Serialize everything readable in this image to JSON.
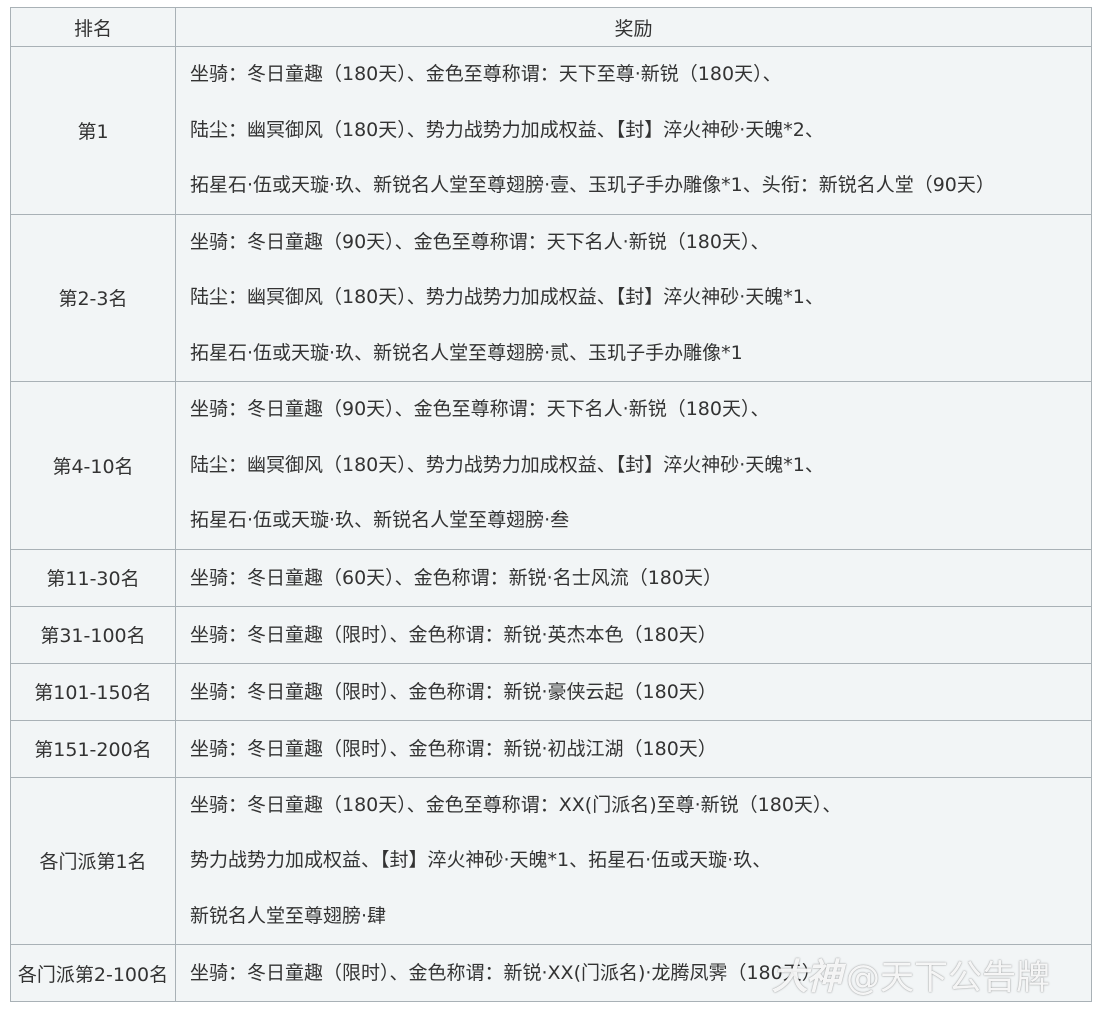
{
  "table": {
    "headers": [
      "排名",
      "奖励"
    ],
    "rows": [
      {
        "rank": "第1",
        "lines": [
          "坐骑：冬日童趣（180天）、金色至尊称谓：天下至尊·新锐（180天）、",
          "陆尘：幽冥御风（180天）、势力战势力加成权益、【封】淬火神砂·天魄*2、",
          "拓星石·伍或天璇·玖、新锐名人堂至尊翅膀·壹、玉玑子手办雕像*1、头衔：新锐名人堂（90天）"
        ]
      },
      {
        "rank": "第2-3名",
        "lines": [
          "坐骑：冬日童趣（90天）、金色至尊称谓：天下名人·新锐（180天）、",
          "陆尘：幽冥御风（180天）、势力战势力加成权益、【封】淬火神砂·天魄*1、",
          "拓星石·伍或天璇·玖、新锐名人堂至尊翅膀·贰、玉玑子手办雕像*1"
        ]
      },
      {
        "rank": "第4-10名",
        "lines": [
          "坐骑：冬日童趣（90天）、金色至尊称谓：天下名人·新锐（180天）、",
          "陆尘：幽冥御风（180天）、势力战势力加成权益、【封】淬火神砂·天魄*1、",
          "拓星石·伍或天璇·玖、新锐名人堂至尊翅膀·叁"
        ]
      },
      {
        "rank": "第11-30名",
        "lines": [
          "坐骑：冬日童趣（60天）、金色称谓：新锐·名士风流（180天）"
        ]
      },
      {
        "rank": "第31-100名",
        "lines": [
          "坐骑：冬日童趣（限时）、金色称谓：新锐·英杰本色（180天）"
        ]
      },
      {
        "rank": "第101-150名",
        "lines": [
          "坐骑：冬日童趣（限时）、金色称谓：新锐·豪侠云起（180天）"
        ]
      },
      {
        "rank": "第151-200名",
        "lines": [
          "坐骑：冬日童趣（限时）、金色称谓：新锐·初战江湖（180天）"
        ]
      },
      {
        "rank": "各门派第1名",
        "lines": [
          "坐骑：冬日童趣（180天）、金色至尊称谓：XX(门派名)至尊·新锐（180天）、",
          "势力战势力加成权益、【封】淬火神砂·天魄*1、拓星石·伍或天璇·玖、",
          "新锐名人堂至尊翅膀·肆"
        ]
      },
      {
        "rank": "各门派第2-100名",
        "lines": [
          "坐骑：冬日童趣（限时）、金色称谓：新锐·XX(门派名)·龙腾凤霁（180天）"
        ]
      }
    ]
  },
  "watermark": {
    "logo": "大神",
    "text": "@天下公告牌"
  }
}
